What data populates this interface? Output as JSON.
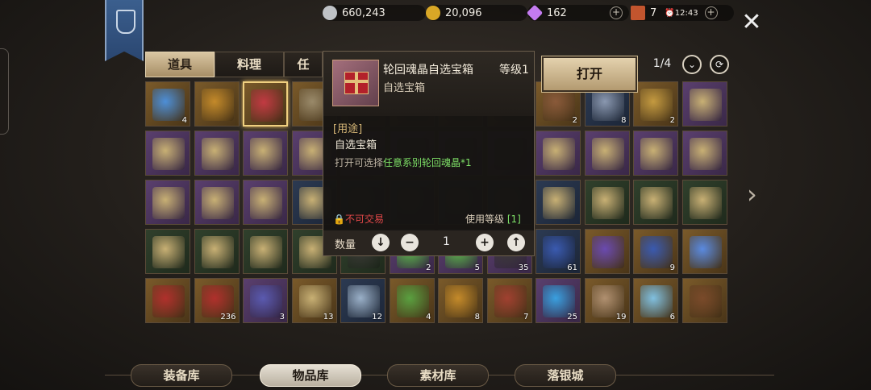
{
  "currencies": [
    {
      "name": "silver",
      "value": "660,243",
      "color": "#bfc2c6",
      "has_plus": false
    },
    {
      "name": "gold",
      "value": "20,096",
      "color": "#d9a726",
      "has_plus": false
    },
    {
      "name": "diamond",
      "value": "162",
      "color": "#c47bf0",
      "has_plus": true
    },
    {
      "name": "ticket",
      "value": "7",
      "color": "#c2552e",
      "has_plus": false
    }
  ],
  "timer": "12:43",
  "tabs": [
    "道具",
    "料理",
    "任"
  ],
  "active_tab": 0,
  "page": "1/4",
  "grid": [
    [
      {
        "q": "gold",
        "c": "#4d8fd8",
        "n": "4"
      },
      {
        "q": "gold",
        "c": "#c48a2a",
        "n": ""
      },
      {
        "q": "gold",
        "c": "#c23a42",
        "n": "",
        "sel": true
      },
      {
        "q": "gold",
        "c": "#9a8a6a",
        "n": ""
      },
      {
        "q": "gold",
        "c": "#3b3a36",
        "n": ""
      },
      {
        "q": "gold",
        "c": "#3b3a36",
        "n": ""
      },
      {
        "q": "gold",
        "c": "#3b3a36",
        "n": ""
      },
      {
        "q": "gold",
        "c": "#3b3a36",
        "n": ""
      },
      {
        "q": "gold",
        "c": "#8a5a3a",
        "n": "2"
      },
      {
        "q": "blue",
        "c": "#8a98b0",
        "n": "8"
      },
      {
        "q": "gold",
        "c": "#c49a40",
        "n": "2"
      },
      {
        "q": "purple",
        "c": "#c8b074",
        "n": ""
      }
    ],
    [
      {
        "q": "purple",
        "c": "#c8b074",
        "n": ""
      },
      {
        "q": "purple",
        "c": "#c8b074",
        "n": ""
      },
      {
        "q": "purple",
        "c": "#c8b074",
        "n": ""
      },
      {
        "q": "purple",
        "c": "#c8b074",
        "n": ""
      },
      {
        "q": "purple",
        "c": "#3b3a36",
        "n": ""
      },
      {
        "q": "purple",
        "c": "#3b3a36",
        "n": ""
      },
      {
        "q": "purple",
        "c": "#3b3a36",
        "n": ""
      },
      {
        "q": "purple",
        "c": "#3b3a36",
        "n": ""
      },
      {
        "q": "purple",
        "c": "#c8b074",
        "n": ""
      },
      {
        "q": "purple",
        "c": "#c8b074",
        "n": ""
      },
      {
        "q": "purple",
        "c": "#c8b074",
        "n": ""
      },
      {
        "q": "purple",
        "c": "#c8b074",
        "n": ""
      }
    ],
    [
      {
        "q": "purple",
        "c": "#c8b074",
        "n": ""
      },
      {
        "q": "purple",
        "c": "#c8b074",
        "n": ""
      },
      {
        "q": "purple",
        "c": "#c8b074",
        "n": ""
      },
      {
        "q": "blue",
        "c": "#c8b074",
        "n": ""
      },
      {
        "q": "blue",
        "c": "#3b3a36",
        "n": ""
      },
      {
        "q": "blue",
        "c": "#3b3a36",
        "n": ""
      },
      {
        "q": "blue",
        "c": "#3b3a36",
        "n": ""
      },
      {
        "q": "blue",
        "c": "#3b3a36",
        "n": ""
      },
      {
        "q": "blue",
        "c": "#c8b074",
        "n": ""
      },
      {
        "q": "green",
        "c": "#c8b074",
        "n": ""
      },
      {
        "q": "green",
        "c": "#c8b074",
        "n": ""
      },
      {
        "q": "green",
        "c": "#c8b074",
        "n": ""
      }
    ],
    [
      {
        "q": "green",
        "c": "#c8b074",
        "n": ""
      },
      {
        "q": "green",
        "c": "#c8b074",
        "n": ""
      },
      {
        "q": "green",
        "c": "#c8b074",
        "n": ""
      },
      {
        "q": "green",
        "c": "#c8b074",
        "n": ""
      },
      {
        "q": "green",
        "c": "#3b3a36",
        "n": ""
      },
      {
        "q": "purple",
        "c": "#5ec04a",
        "n": "2"
      },
      {
        "q": "purple",
        "c": "#5ec04a",
        "n": "5"
      },
      {
        "q": "purple",
        "c": "#3b3a36",
        "n": "35"
      },
      {
        "q": "blue",
        "c": "#3a5ab0",
        "n": "61"
      },
      {
        "q": "gold",
        "c": "#6a4ab0",
        "n": ""
      },
      {
        "q": "gold",
        "c": "#3a5ab0",
        "n": "9"
      },
      {
        "q": "gold",
        "c": "#5a8ae0",
        "n": ""
      }
    ],
    [
      {
        "q": "gold",
        "c": "#b0302c",
        "n": ""
      },
      {
        "q": "gold",
        "c": "#b0302c",
        "n": "236"
      },
      {
        "q": "purple",
        "c": "#5a5ab0",
        "n": "3"
      },
      {
        "q": "gold",
        "c": "#c8b074",
        "n": "13"
      },
      {
        "q": "blue",
        "c": "#9ab0c8",
        "n": "12"
      },
      {
        "q": "gold",
        "c": "#5aa040",
        "n": "4"
      },
      {
        "q": "gold",
        "c": "#c48a2a",
        "n": "8"
      },
      {
        "q": "gold",
        "c": "#a04030",
        "n": "7"
      },
      {
        "q": "purple",
        "c": "#3aa0e0",
        "n": "25"
      },
      {
        "q": "gold",
        "c": "#b09070",
        "n": "19"
      },
      {
        "q": "gold",
        "c": "#80c0e0",
        "n": "6"
      },
      {
        "q": "gold",
        "c": "#7a4a2a",
        "n": ""
      }
    ]
  ],
  "popup": {
    "title": "轮回魂晶自选宝箱",
    "level": "等级1",
    "subtitle": "自选宝箱",
    "usage_header": "[用途]",
    "description": "自选宝箱",
    "detail_prefix": "打开可选择",
    "detail_highlight": "任意系别轮回魂晶*1",
    "untradable": "不可交易",
    "use_level_label": "使用等级",
    "use_level_value": "[1]",
    "quantity_label": "数量",
    "quantity": "1"
  },
  "open_button": "打开",
  "bottom_tabs": [
    "装备库",
    "物品库",
    "素材库",
    "落银城"
  ],
  "active_bottom_tab": 1
}
